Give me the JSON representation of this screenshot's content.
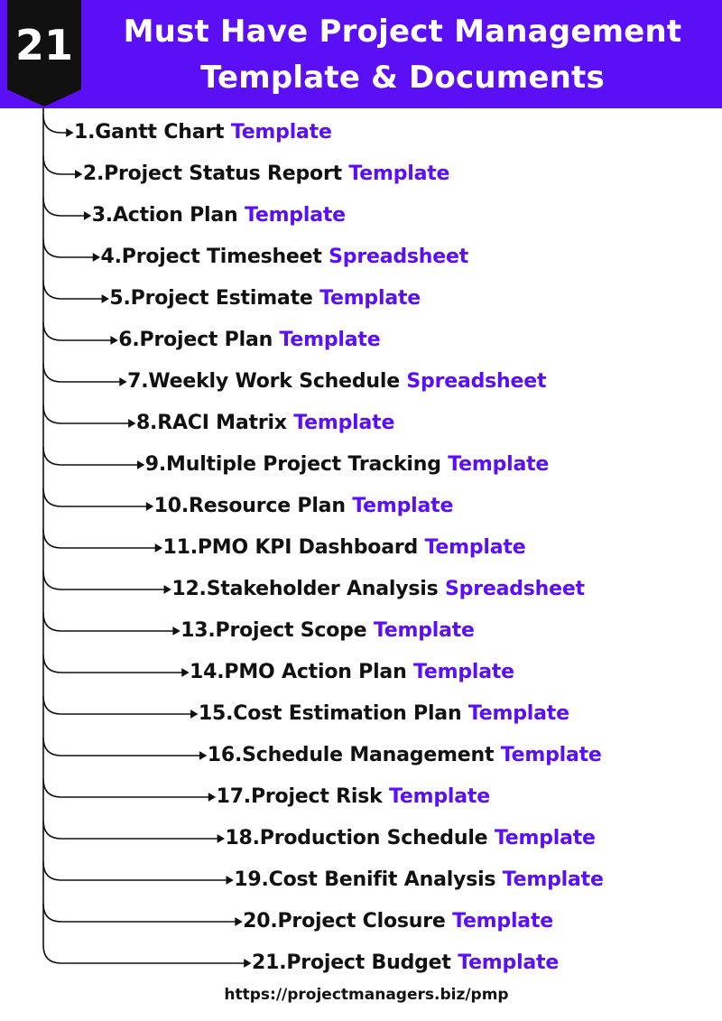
{
  "badge": {
    "number": "21"
  },
  "header": {
    "title_line1": "Must Have Project Management",
    "title_line2": "Template & Documents",
    "bg_color": "#5a0ff5"
  },
  "items": [
    {
      "label": "1.Gantt Chart",
      "kind": "Template"
    },
    {
      "label": "2.Project Status Report",
      "kind": "Template"
    },
    {
      "label": "3.Action Plan",
      "kind": "Template"
    },
    {
      "label": "4.Project Timesheet",
      "kind": "Spreadsheet"
    },
    {
      "label": "5.Project Estimate",
      "kind": "Template"
    },
    {
      "label": "6.Project Plan",
      "kind": "Template"
    },
    {
      "label": "7.Weekly Work Schedule",
      "kind": "Spreadsheet"
    },
    {
      "label": "8.RACI Matrix",
      "kind": "Template"
    },
    {
      "label": "9.Multiple Project Tracking",
      "kind": "Template"
    },
    {
      "label": "10.Resource Plan",
      "kind": "Template"
    },
    {
      "label": "11.PMO KPI Dashboard",
      "kind": "Template"
    },
    {
      "label": "12.Stakeholder Analysis",
      "kind": "Spreadsheet"
    },
    {
      "label": "13.Project Scope",
      "kind": "Template"
    },
    {
      "label": "14.PMO Action Plan",
      "kind": "Template"
    },
    {
      "label": "15.Cost Estimation Plan",
      "kind": "Template"
    },
    {
      "label": "16.Schedule Management",
      "kind": "Template"
    },
    {
      "label": "17.Project Risk",
      "kind": "Template"
    },
    {
      "label": "18.Production Schedule",
      "kind": "Template"
    },
    {
      "label": "19.Cost Benifit Analysis",
      "kind": "Template"
    },
    {
      "label": "20.Project Closure",
      "kind": "Template"
    },
    {
      "label": "21.Project Budget",
      "kind": "Template"
    }
  ],
  "footer": {
    "url": "https://projectmanagers.biz/pmp"
  }
}
